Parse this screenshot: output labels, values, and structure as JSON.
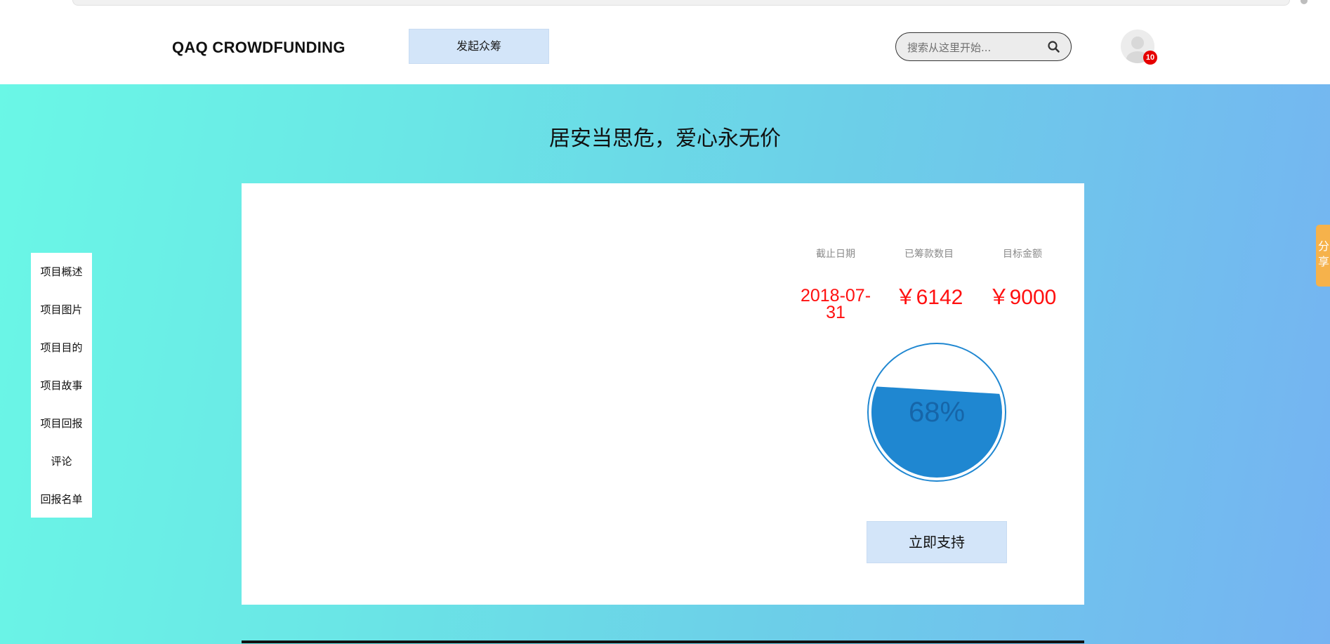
{
  "header": {
    "brand": "QAQ CROWDFUNDING",
    "launch_label": "发起众筹",
    "search_placeholder": "搜索从这里开始...",
    "notifications_count": "10"
  },
  "main": {
    "slogan": "居安当思危，爱心永无价"
  },
  "side_nav": {
    "items": [
      "项目概述",
      "项目图片",
      "项目目的",
      "项目故事",
      "项目回报",
      "评论",
      "回报名单"
    ]
  },
  "project": {
    "stats": {
      "deadline_label": "截止日期",
      "raised_label": "已筹款数目",
      "target_label": "目标金额",
      "deadline_line1": "2018-07-",
      "deadline_line2": "31",
      "raised_value": "￥6142",
      "target_value": "￥9000"
    },
    "progress_percent": 68,
    "progress_text": "68%",
    "support_label": "立即支持"
  },
  "share": {
    "label_line1": "分",
    "label_line2": "享"
  },
  "colors": {
    "accent_button": "#d3e5f9",
    "progress_fill": "#1f87d1",
    "stat_value": "#ff1010",
    "badge": "#e60000",
    "share_tab": "#f6b24b"
  }
}
